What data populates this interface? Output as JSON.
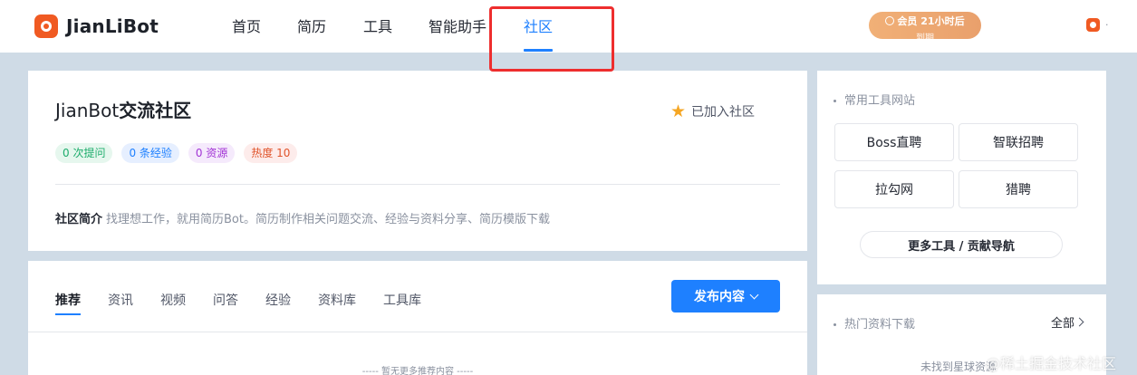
{
  "brand": {
    "name": "JianLiBot"
  },
  "nav": {
    "items": [
      {
        "label": "首页"
      },
      {
        "label": "简历"
      },
      {
        "label": "工具"
      },
      {
        "label": "智能助手"
      },
      {
        "label": "社区",
        "active": true
      }
    ]
  },
  "vip": {
    "label": "会员",
    "countdown": "21小时后",
    "suffix": "到期"
  },
  "header_right": {
    "dot": "."
  },
  "community": {
    "name_prefix": "JianBot",
    "name_suffix": "交流社区",
    "joined_label": "已加入社区",
    "stats": [
      {
        "text": "0 次提问",
        "color": "#1dac6c"
      },
      {
        "text": "0 条经验",
        "color": "#1e80ff"
      },
      {
        "text": "0 资源",
        "color": "#a234d5"
      },
      {
        "text": "热度 10",
        "color": "#e0542b"
      }
    ],
    "intro_label": "社区简介",
    "intro_text": "找理想工作，就用简历Bot。简历制作相关问题交流、经验与资料分享、简历模版下载"
  },
  "feed": {
    "tabs": [
      {
        "label": "推荐",
        "active": true
      },
      {
        "label": "资讯"
      },
      {
        "label": "视频"
      },
      {
        "label": "问答"
      },
      {
        "label": "经验"
      },
      {
        "label": "资料库"
      },
      {
        "label": "工具库"
      }
    ],
    "publish_label": "发布内容",
    "empty_text": "----- 暂无更多推荐内容 -----"
  },
  "tools": {
    "title": "常用工具网站",
    "items": [
      {
        "label": "Boss直聘"
      },
      {
        "label": "智联招聘"
      },
      {
        "label": "拉勾网"
      },
      {
        "label": "猎聘"
      }
    ],
    "more_label": "更多工具 / 贡献导航"
  },
  "hot": {
    "title": "热门资料下载",
    "all_label": "全部",
    "empty_text": "未找到星球资源"
  },
  "watermark": "@稀土掘金技术社区",
  "icons": [
    "logo-icon",
    "clock-icon",
    "star-icon",
    "chevron-down-icon",
    "chevron-right-icon",
    "user-logo-icon"
  ],
  "colors": {
    "accent": "#1e80ff",
    "brand": "#f05a22",
    "vip": "#f1b077",
    "star": "#f5a623",
    "highlight_box": "#ee2e2e"
  }
}
